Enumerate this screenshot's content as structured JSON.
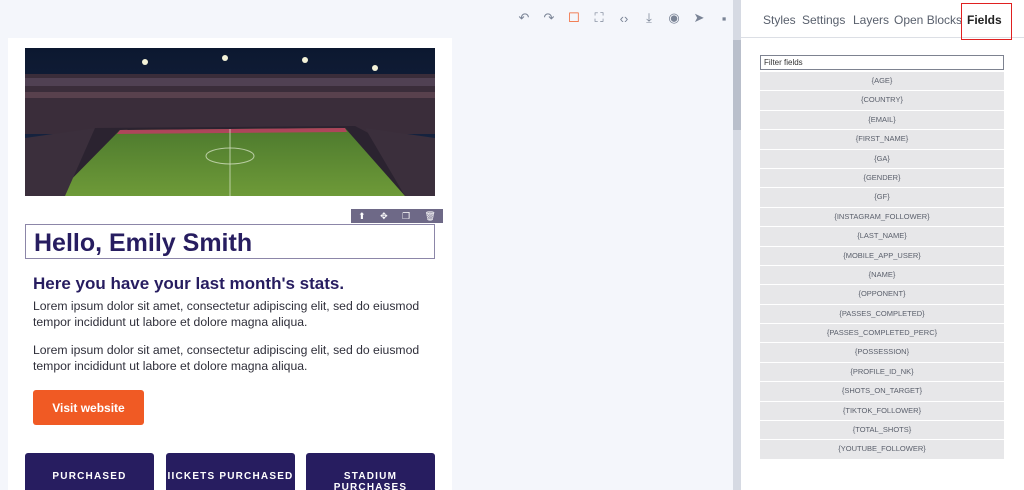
{
  "toolbar": {
    "buttons": [
      {
        "name": "undo-icon",
        "glyph": "↶"
      },
      {
        "name": "redo-icon",
        "glyph": "↷"
      },
      {
        "name": "select-frame-icon",
        "glyph": "☐"
      },
      {
        "name": "fullscreen-icon",
        "glyph": "⛶"
      },
      {
        "name": "code-icon",
        "glyph": "‹›"
      },
      {
        "name": "import-icon",
        "glyph": "⤓"
      },
      {
        "name": "preview-icon",
        "glyph": "◉"
      },
      {
        "name": "send-icon",
        "glyph": "➤"
      },
      {
        "name": "save-icon",
        "glyph": "▪"
      }
    ],
    "accent_color": "#f05a24"
  },
  "email": {
    "block_tools": [
      {
        "name": "move-up-icon",
        "glyph": "⬆"
      },
      {
        "name": "drag-move-icon",
        "glyph": "✥"
      },
      {
        "name": "duplicate-icon",
        "glyph": "❐"
      },
      {
        "name": "delete-icon",
        "glyph": "🗑"
      }
    ],
    "greeting": "Hello, Emily Smith",
    "subheading": "Here you have your last month's stats.",
    "paragraph1": "Lorem ipsum dolor sit amet, consectetur adipiscing elit, sed do eiusmod tempor incididunt ut labore et dolore magna aliqua.",
    "paragraph2": "Lorem ipsum dolor sit amet, consectetur adipiscing elit, sed do eiusmod tempor incididunt ut labore et dolore magna aliqua.",
    "cta_label": "Visit website",
    "stats": [
      "PURCHASED",
      "IICKETS PURCHASED",
      "STADIUM PURCHASES"
    ],
    "colors": {
      "heading": "#271d60",
      "cta": "#f05a24",
      "stat_card": "#271d60"
    }
  },
  "panel": {
    "tabs": [
      "Styles",
      "Settings",
      "Layers",
      "Open Blocks",
      "Fields"
    ],
    "active_tab": "Fields",
    "filter_placeholder": "Filter fields",
    "fields": [
      "{AGE}",
      "{COUNTRY}",
      "{EMAIL}",
      "{FIRST_NAME}",
      "{GA}",
      "{GENDER}",
      "{GF}",
      "{INSTAGRAM_FOLLOWER}",
      "{LAST_NAME}",
      "{MOBILE_APP_USER}",
      "{NAME}",
      "{OPPONENT}",
      "{PASSES_COMPLETED}",
      "{PASSES_COMPLETED_PERC}",
      "{POSSESSION}",
      "{PROFILE_ID_NK}",
      "{SHOTS_ON_TARGET}",
      "{TIKTOK_FOLLOWER}",
      "{TOTAL_SHOTS}",
      "{YOUTUBE_FOLLOWER}"
    ]
  }
}
